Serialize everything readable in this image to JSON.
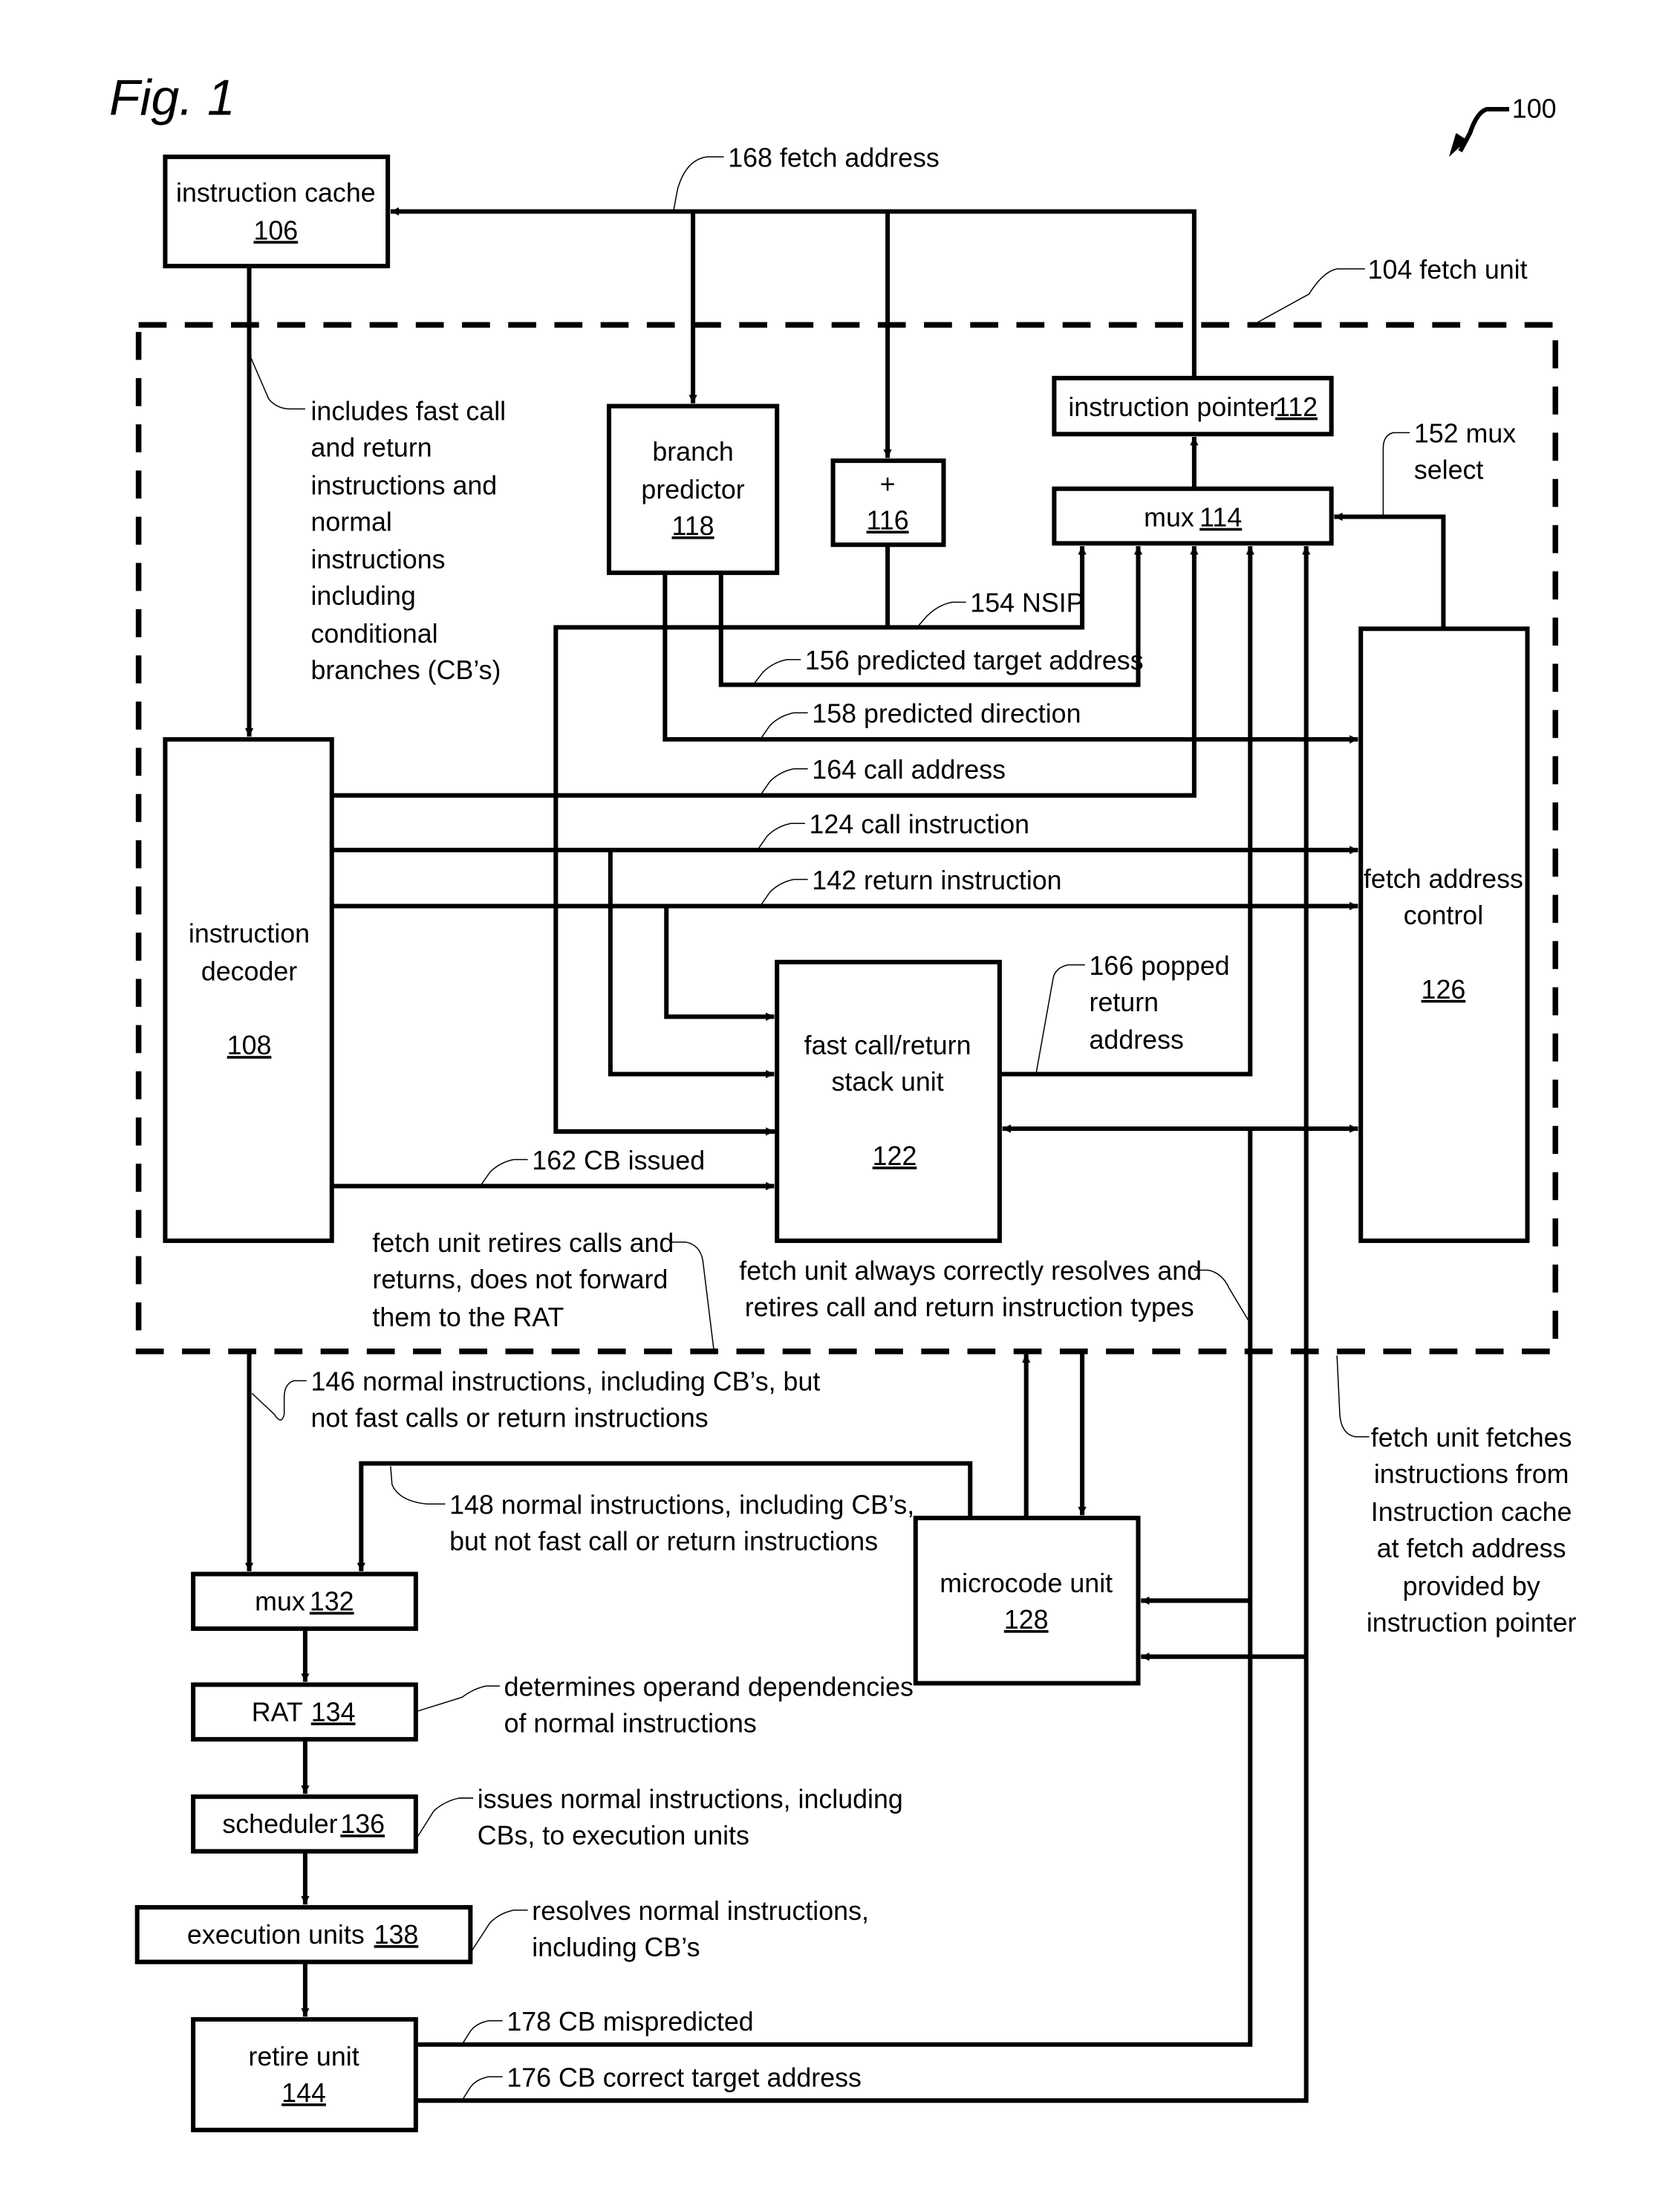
{
  "figure": {
    "title": "Fig. 1",
    "ref_number": "100"
  },
  "fetch_unit": {
    "label": "104 fetch unit"
  },
  "blocks": {
    "instruction_cache": {
      "name": "instruction cache",
      "ref": "106"
    },
    "branch_predictor": {
      "name_line1": "branch",
      "name_line2": "predictor",
      "ref": "118"
    },
    "adder": {
      "name": "+",
      "ref": "116"
    },
    "instruction_pointer": {
      "name": "instruction pointer",
      "ref": "112"
    },
    "mux_114": {
      "name": "mux",
      "ref": "114"
    },
    "instruction_decoder": {
      "name_line1": "instruction",
      "name_line2": "decoder",
      "ref": "108"
    },
    "fast_call_return_stack": {
      "name_line1": "fast call/return",
      "name_line2": "stack unit",
      "ref": "122"
    },
    "fetch_address_control": {
      "name_line1": "fetch address",
      "name_line2": "control",
      "ref": "126"
    },
    "microcode_unit": {
      "name": "microcode unit",
      "ref": "128"
    },
    "mux_132": {
      "name": "mux",
      "ref": "132"
    },
    "rat": {
      "name": "RAT",
      "ref": "134"
    },
    "scheduler": {
      "name": "scheduler",
      "ref": "136"
    },
    "execution_units": {
      "name": "execution units",
      "ref": "138"
    },
    "retire_unit": {
      "name": "retire unit",
      "ref": "144"
    }
  },
  "signals": {
    "fetch_address": "168 fetch address",
    "mux_select_line1": "152 mux",
    "mux_select_line2": "select",
    "nsip": "154 NSIP",
    "predicted_target": "156 predicted target address",
    "predicted_direction": "158 predicted direction",
    "call_address": "164 call address",
    "call_instruction": "124 call instruction",
    "return_instruction": "142 return instruction",
    "popped_return_line1": "166 popped",
    "popped_return_line2": "return",
    "popped_return_line3": "address",
    "cb_issued": "162 CB issued",
    "cb_mispredicted": "178 CB mispredicted",
    "cb_correct_target": "176 CB correct target address"
  },
  "annotations": {
    "decoder_input": [
      "includes fast call",
      "and return",
      "instructions and",
      "normal",
      "instructions",
      "including",
      "conditional",
      "branches (CB’s)"
    ],
    "retires_calls": [
      "fetch unit retires calls and",
      "returns, does not forward",
      "them to the RAT"
    ],
    "always_resolves": [
      "fetch unit always correctly resolves and",
      "retires call and return instruction types"
    ],
    "normal_146": [
      "146 normal instructions, including CB’s, but",
      "not fast calls or return instructions"
    ],
    "normal_148": [
      "148 normal instructions, including CB’s,",
      "but not fast call or return instructions"
    ],
    "fetches_from_cache": [
      "fetch unit fetches",
      "instructions from",
      "Instruction cache",
      "at fetch address",
      "provided by",
      "instruction pointer"
    ],
    "rat_note": [
      "determines operand dependencies",
      "of normal instructions"
    ],
    "scheduler_note": [
      "issues normal instructions, including",
      "CBs, to execution units"
    ],
    "execution_note": [
      "resolves normal instructions,",
      "including CB’s"
    ]
  }
}
